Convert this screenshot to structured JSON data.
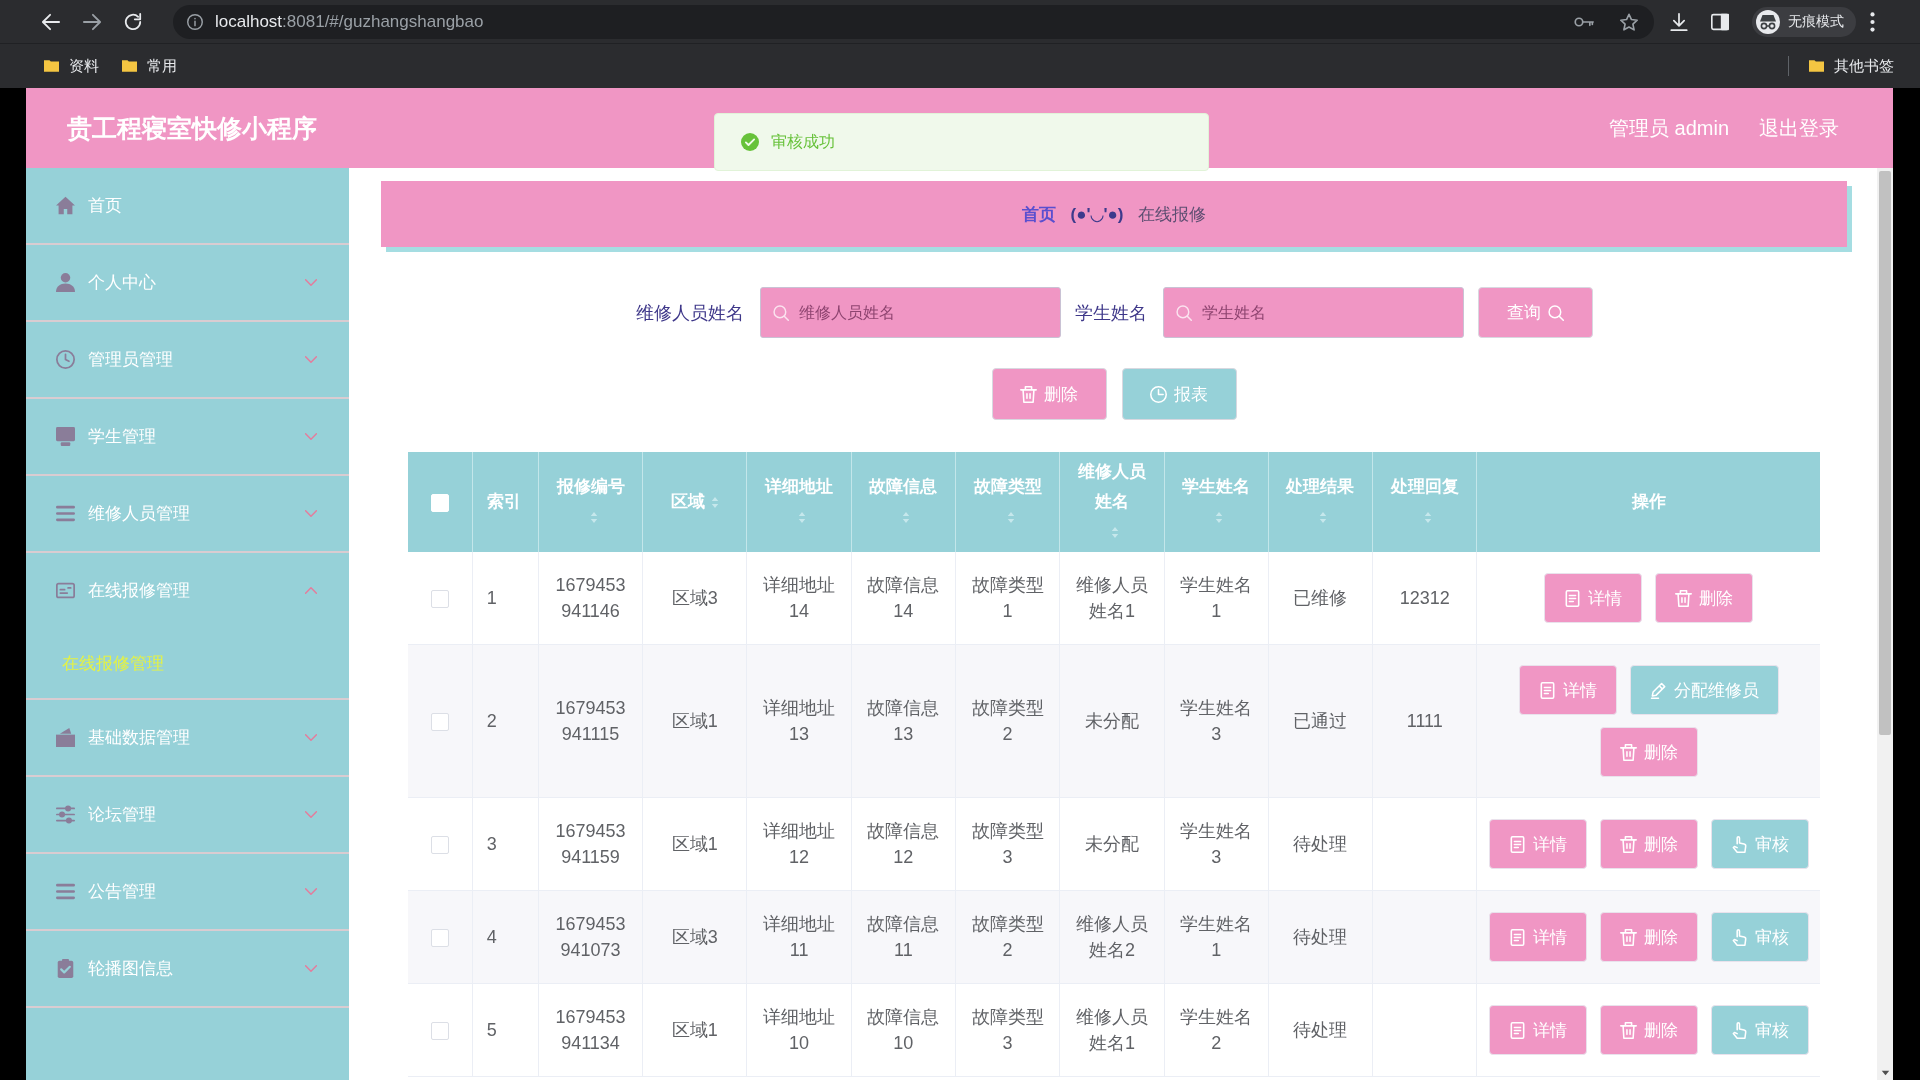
{
  "browser": {
    "url_host": "localhost",
    "url_rest": ":8081/#/guzhangshangbao",
    "profile": "无痕模式",
    "bookmarks": [
      "资料",
      "常用"
    ],
    "other_bookmarks": "其他书签"
  },
  "header": {
    "title": "贵工程寝室快修小程序",
    "user": "管理员 admin",
    "logout": "退出登录"
  },
  "toast": {
    "kind": "success",
    "message": "审核成功"
  },
  "sidebar": {
    "items": [
      {
        "label": "首页",
        "kind": "link",
        "selected": false
      },
      {
        "label": "个人中心",
        "kind": "menu",
        "selected": false,
        "expanded": false
      },
      {
        "label": "管理员管理",
        "kind": "menu",
        "selected": false,
        "expanded": false
      },
      {
        "label": "学生管理",
        "kind": "menu",
        "selected": false,
        "expanded": false
      },
      {
        "label": "维修人员管理",
        "kind": "menu",
        "selected": false,
        "expanded": false
      },
      {
        "label": "在线报修管理",
        "kind": "menu",
        "selected": false,
        "expanded": true,
        "children": [
          {
            "label": "在线报修管理",
            "selected": true
          }
        ]
      },
      {
        "label": "基础数据管理",
        "kind": "menu",
        "selected": false,
        "expanded": false
      },
      {
        "label": "论坛管理",
        "kind": "menu",
        "selected": false,
        "expanded": false
      },
      {
        "label": "公告管理",
        "kind": "menu",
        "selected": false,
        "expanded": false
      },
      {
        "label": "轮播图信息",
        "kind": "menu",
        "selected": false,
        "expanded": false
      }
    ]
  },
  "breadcrumb": {
    "items": [
      "首页",
      "在线报修"
    ],
    "separator": "(●'◡'●)"
  },
  "search": {
    "fields": [
      {
        "label": "维修人员姓名",
        "placeholder": "维修人员姓名"
      },
      {
        "label": "学生姓名",
        "placeholder": "学生姓名"
      }
    ],
    "button": "查询"
  },
  "actions": [
    {
      "kind": "delete",
      "label": "删除"
    },
    {
      "kind": "report",
      "label": "报表"
    }
  ],
  "table": {
    "select_all_checked": false,
    "columns": [
      {
        "label": "索引",
        "sortable": false
      },
      {
        "label": "报修编号",
        "sortable": true
      },
      {
        "label": "区域",
        "sortable": true
      },
      {
        "label": "详细地址",
        "sortable": true
      },
      {
        "label": "故障信息",
        "sortable": true
      },
      {
        "label": "故障类型",
        "sortable": true
      },
      {
        "label": "维修人员姓名",
        "sortable": true
      },
      {
        "label": "学生姓名",
        "sortable": true
      },
      {
        "label": "处理结果",
        "sortable": true
      },
      {
        "label": "处理回复",
        "sortable": true
      },
      {
        "label": "操作",
        "sortable": false
      }
    ],
    "rows": [
      {
        "checked": false,
        "index": "1",
        "number": "1679453941146",
        "area": "区域3",
        "address": "详细地址14",
        "fault_info": "故障信息14",
        "fault_type": "故障类型1",
        "repairman": "维修人员姓名1",
        "student": "学生姓名1",
        "result": "已维修",
        "reply": "12312",
        "actions": [
          {
            "kind": "detail",
            "label": "详情"
          },
          {
            "kind": "delete",
            "label": "删除"
          }
        ]
      },
      {
        "checked": false,
        "index": "2",
        "number": "1679453941115",
        "area": "区域1",
        "address": "详细地址13",
        "fault_info": "故障信息13",
        "fault_type": "故障类型2",
        "repairman": "未分配",
        "student": "学生姓名3",
        "result": "已通过",
        "reply": "1111",
        "actions": [
          {
            "kind": "detail",
            "label": "详情"
          },
          {
            "kind": "assign",
            "label": "分配维修员"
          },
          {
            "kind": "delete",
            "label": "删除"
          }
        ]
      },
      {
        "checked": false,
        "index": "3",
        "number": "1679453941159",
        "area": "区域1",
        "address": "详细地址12",
        "fault_info": "故障信息12",
        "fault_type": "故障类型3",
        "repairman": "未分配",
        "student": "学生姓名3",
        "result": "待处理",
        "actions": [
          {
            "kind": "detail",
            "label": "详情"
          },
          {
            "kind": "delete",
            "label": "删除"
          },
          {
            "kind": "review",
            "label": "审核"
          }
        ]
      },
      {
        "checked": false,
        "index": "4",
        "number": "1679453941073",
        "area": "区域3",
        "address": "详细地址11",
        "fault_info": "故障信息11",
        "fault_type": "故障类型2",
        "repairman": "维修人员姓名2",
        "student": "学生姓名1",
        "result": "待处理",
        "actions": [
          {
            "kind": "detail",
            "label": "详情"
          },
          {
            "kind": "delete",
            "label": "删除"
          },
          {
            "kind": "review",
            "label": "审核"
          }
        ]
      },
      {
        "checked": false,
        "index": "5",
        "number": "1679453941134",
        "area": "区域1",
        "address": "详细地址10",
        "fault_info": "故障信息10",
        "fault_type": "故障类型3",
        "repairman": "维修人员姓名1",
        "student": "学生姓名2",
        "result": "待处理",
        "actions": [
          {
            "kind": "detail",
            "label": "详情"
          },
          {
            "kind": "delete",
            "label": "删除"
          },
          {
            "kind": "review",
            "label": "审核"
          }
        ]
      }
    ]
  }
}
